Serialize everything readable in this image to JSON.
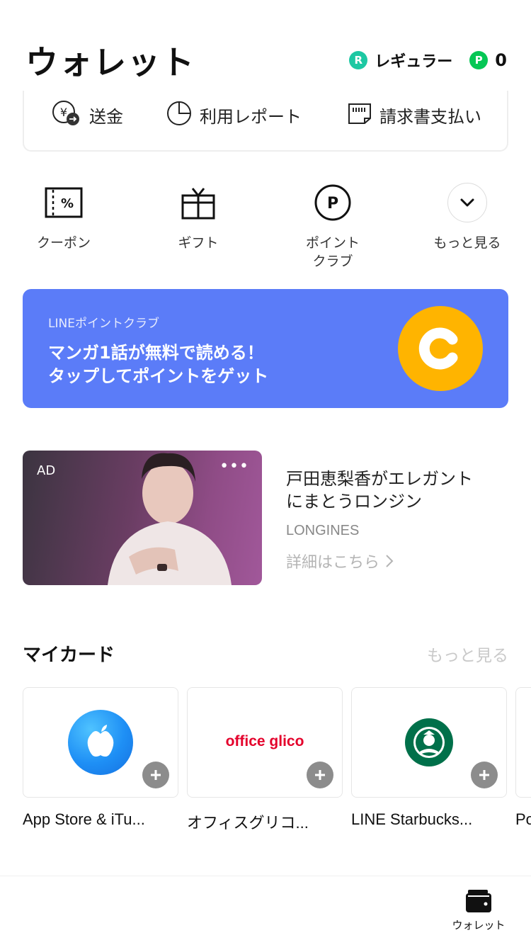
{
  "header": {
    "title": "ウォレット",
    "rank_badge": "R",
    "rank": "レギュラー",
    "points_badge": "P",
    "points": "0"
  },
  "actions": {
    "transfer": "送金",
    "report": "利用レポート",
    "bill_pay": "請求書支払い"
  },
  "quick_menu": {
    "coupon": "クーポン",
    "gift": "ギフト",
    "points_club_line1": "ポイント",
    "points_club_line2": "クラブ",
    "more": "もっと見る"
  },
  "promo": {
    "kicker": "LINEポイントクラブ",
    "line1": "マンガ1話が無料で読める！",
    "line2": "タップしてポイントをゲット",
    "accent": "#5b7cf8"
  },
  "ad": {
    "label": "AD",
    "menu": "•••",
    "title_line1": "戸田恵梨香がエレガント",
    "title_line2": "にまとうロンジン",
    "brand": "LONGINES",
    "link": "詳細はこちら"
  },
  "my_cards": {
    "title": "マイカード",
    "more": "もっと見る",
    "cards": [
      {
        "name": "App Store & iTu..."
      },
      {
        "name": "オフィスグリコ...",
        "logo_text": "office glico"
      },
      {
        "name": "LINE Starbucks..."
      },
      {
        "name": "Po"
      }
    ]
  },
  "tabbar": {
    "wallet": "ウォレット"
  }
}
